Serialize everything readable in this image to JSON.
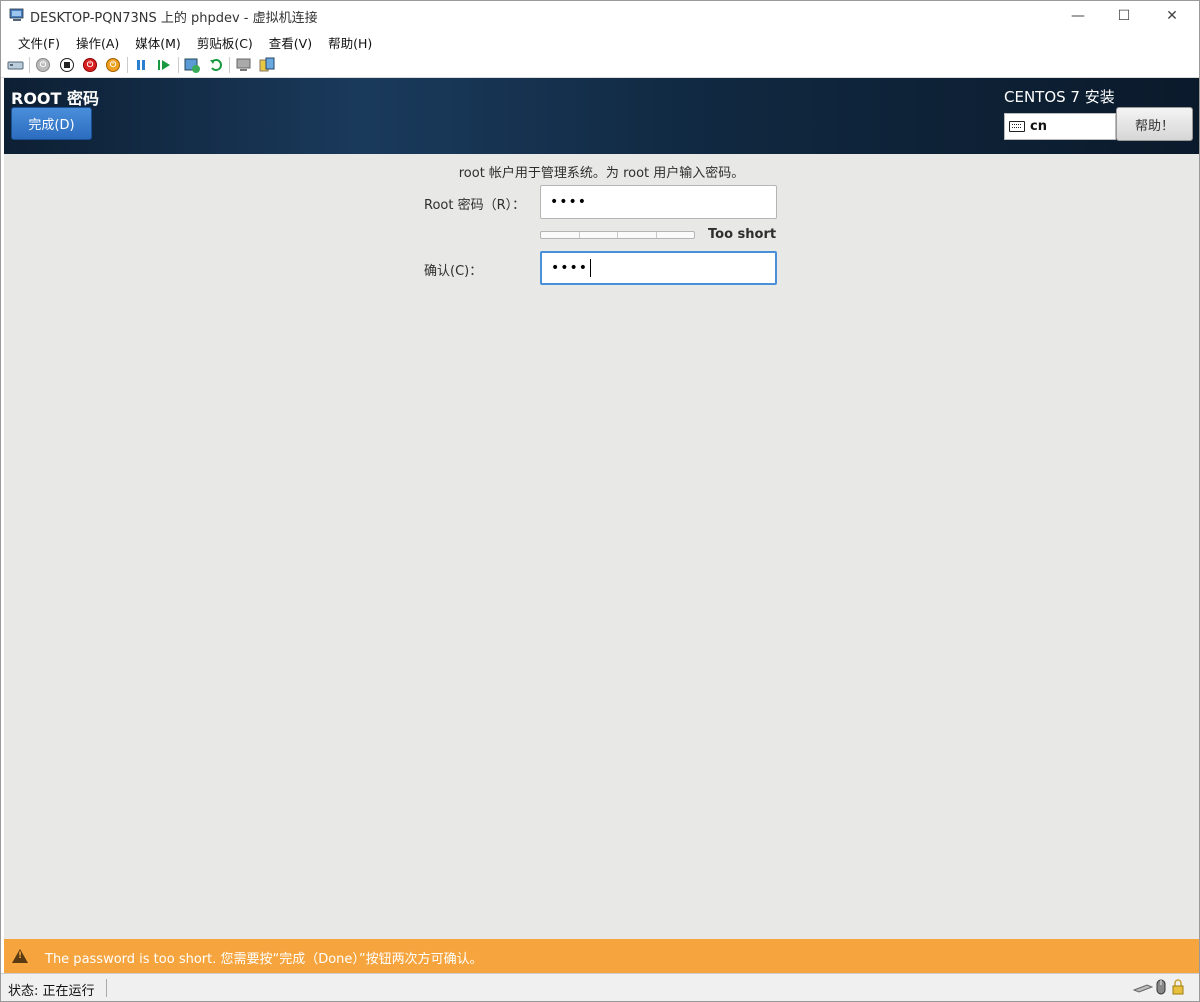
{
  "window": {
    "title": "DESKTOP-PQN73NS 上的 phpdev - 虚拟机连接",
    "minimize_glyph": "—",
    "maximize_glyph": "☐",
    "close_glyph": "✕"
  },
  "menubar": {
    "items": [
      {
        "label": "文件(F)"
      },
      {
        "label": "操作(A)"
      },
      {
        "label": "媒体(M)"
      },
      {
        "label": "剪贴板(C)"
      },
      {
        "label": "查看(V)"
      },
      {
        "label": "帮助(H)"
      }
    ]
  },
  "toolbar": {
    "icons": [
      "ctrl-alt-del-icon",
      "start-icon",
      "turn-off-icon",
      "shutdown-icon",
      "save-icon",
      "pause-icon",
      "resume-icon",
      "checkpoint-icon",
      "revert-icon",
      "enhanced-session-icon",
      "share-icon"
    ]
  },
  "header": {
    "spoke_title": "ROOT 密码",
    "done_label": "完成(D)",
    "product_title": "CENTOS 7 安装",
    "keyboard_layout": "cn",
    "help_label": "帮助！"
  },
  "form": {
    "description": "root 帐户用于管理系统。为 root 用户输入密码。",
    "root_password_label": "Root 密码（R）：",
    "root_password_value": "••••",
    "strength_label": "Too short",
    "strength_level": 0,
    "confirm_label": "确认(C)：",
    "confirm_value": "••••"
  },
  "warning": {
    "text": "The password is too short. 您需要按“完成（Done）”按钮两次方可确认。",
    "color": "#f6a53e"
  },
  "statusbar": {
    "status": "状态: 正在运行"
  },
  "colors": {
    "header_dark": "#0d1f33",
    "done_button": "#2c6cbf",
    "focus_border": "#4a90d9",
    "content_bg": "#e8e8e7"
  }
}
